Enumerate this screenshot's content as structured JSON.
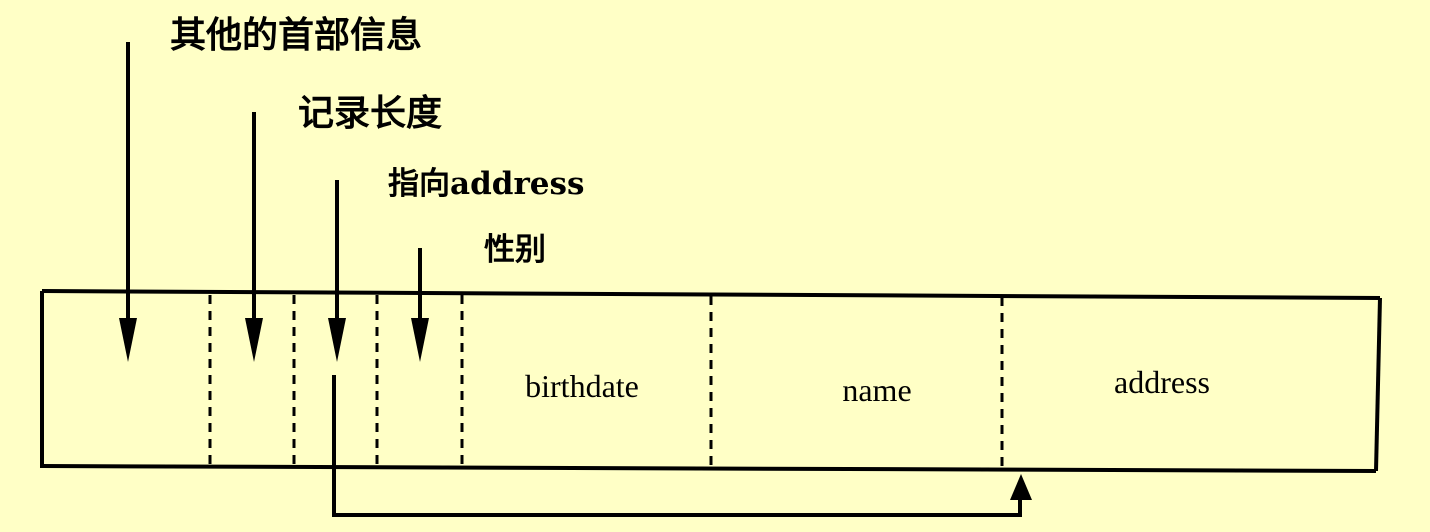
{
  "labels": {
    "other_header": "其他的首部信息",
    "record_length": "记录长度",
    "address_pointer": "指向address",
    "gender": "性别"
  },
  "fields": {
    "birthdate": "birthdate",
    "name": "name",
    "address": "address"
  },
  "colors": {
    "background": "#ffffc6",
    "ink": "#000000"
  }
}
